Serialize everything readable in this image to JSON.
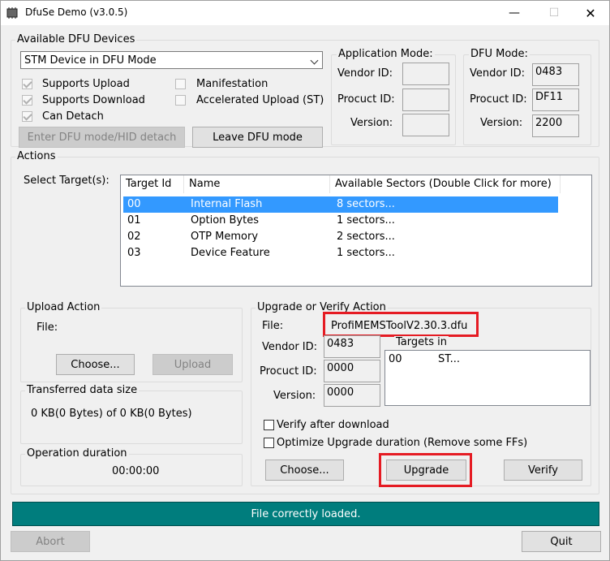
{
  "window": {
    "title": "DfuSe Demo (v3.0.5)",
    "controls": {
      "minimize": "—",
      "maximize": "☐",
      "close": "✕"
    }
  },
  "dfu_devices": {
    "group_title": "Available DFU Devices",
    "selected_device": "STM Device in DFU Mode",
    "checkboxes": [
      {
        "label": "Supports Upload",
        "checked": true
      },
      {
        "label": "Supports Download",
        "checked": true
      },
      {
        "label": "Can Detach",
        "checked": true
      },
      {
        "label": "Manifestation",
        "checked": false
      },
      {
        "label": "Accelerated Upload (ST)",
        "checked": false
      }
    ],
    "enter_dfu_button": "Enter DFU mode/HID detach",
    "leave_dfu_button": "Leave DFU mode"
  },
  "application_mode": {
    "group_title": "Application Mode:",
    "vendor_label": "Vendor ID:",
    "product_label": "Procuct ID:",
    "version_label": "Version:",
    "vendor_value": "",
    "product_value": "",
    "version_value": ""
  },
  "dfu_mode": {
    "group_title": "DFU Mode:",
    "vendor_label": "Vendor ID:",
    "product_label": "Procuct ID:",
    "version_label": "Version:",
    "vendor_value": "0483",
    "product_value": "DF11",
    "version_value": "2200"
  },
  "actions": {
    "group_title": "Actions",
    "select_target_label": "Select Target(s):",
    "columns": [
      "Target Id",
      "Name",
      "Available Sectors (Double Click for more)"
    ],
    "targets": [
      {
        "id": "00",
        "name": "Internal Flash",
        "sectors": "8 sectors...",
        "selected": true
      },
      {
        "id": "01",
        "name": "Option Bytes",
        "sectors": "1 sectors...",
        "selected": false
      },
      {
        "id": "02",
        "name": "OTP Memory",
        "sectors": "2 sectors...",
        "selected": false
      },
      {
        "id": "03",
        "name": "Device Feature",
        "sectors": "1 sectors...",
        "selected": false
      }
    ]
  },
  "upload_action": {
    "group_title": "Upload Action",
    "file_label": "File:",
    "choose_button": "Choose...",
    "upload_button": "Upload"
  },
  "transferred": {
    "group_title": "Transferred data size",
    "value": "0 KB(0 Bytes) of 0 KB(0 Bytes)"
  },
  "operation": {
    "group_title": "Operation duration",
    "value": "00:00:00"
  },
  "upgrade_action": {
    "group_title": "Upgrade or Verify Action",
    "file_label": "File:",
    "file_value": "ProfiMEMSToolV2.30.3.dfu",
    "vendor_label": "Vendor ID:",
    "vendor_value": "0483",
    "product_label": "Procuct ID:",
    "product_value": "0000",
    "version_label": "Version:",
    "version_value": "0000",
    "targets_in_label": "Targets in",
    "targets_in": [
      {
        "id": "00",
        "name": "ST..."
      }
    ],
    "verify_after_download": "Verify after download",
    "optimize_upgrade": "Optimize Upgrade duration (Remove some FFs)",
    "choose_button": "Choose...",
    "upgrade_button": "Upgrade",
    "verify_button": "Verify"
  },
  "status": {
    "message": "File correctly loaded."
  },
  "bottom": {
    "abort_button": "Abort",
    "quit_button": "Quit"
  },
  "colors": {
    "status_bar": "#007d7d",
    "selection": "#3399ff",
    "highlight_box": "#e51b23"
  }
}
